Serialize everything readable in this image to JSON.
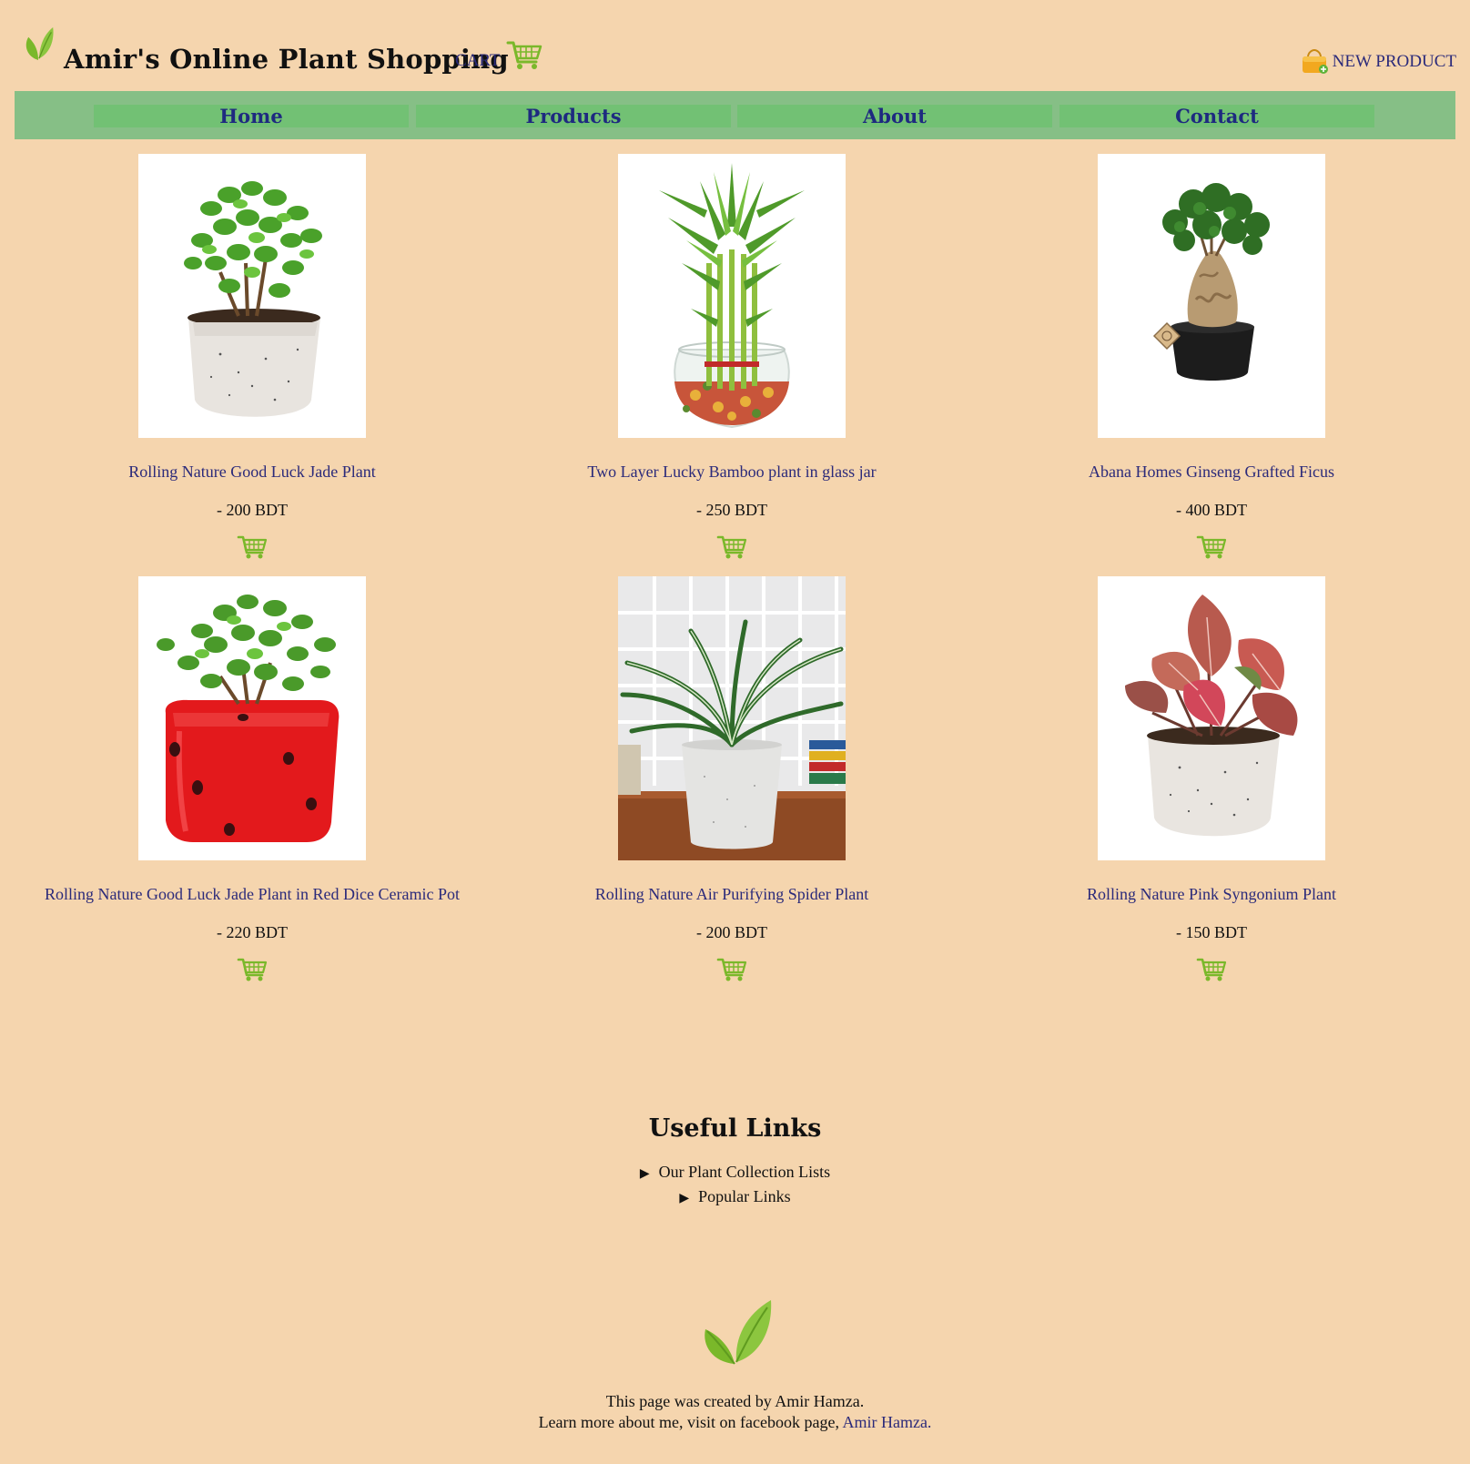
{
  "header": {
    "title": "Amir's Online Plant Shopping",
    "cart_label": "CART",
    "new_product_label": "NEW PRODUCT"
  },
  "nav": {
    "items": [
      "Home",
      "Products",
      "About",
      "Contact"
    ]
  },
  "products": [
    {
      "name": "Rolling Nature Good Luck Jade Plant",
      "price": "- 200 BDT",
      "image": "jade-plant-white-pot"
    },
    {
      "name": "Two Layer Lucky Bamboo plant in glass jar",
      "price": "- 250 BDT",
      "image": "lucky-bamboo-glass-jar"
    },
    {
      "name": "Abana Homes Ginseng Grafted Ficus",
      "price": "- 400 BDT",
      "image": "ginseng-ficus-black-pot"
    },
    {
      "name": "Rolling Nature Good Luck Jade Plant in Red Dice Ceramic Pot",
      "price": "- 220 BDT",
      "image": "jade-plant-red-dice-pot"
    },
    {
      "name": "Rolling Nature Air Purifying Spider Plant",
      "price": "- 200 BDT",
      "image": "spider-plant-white-pot"
    },
    {
      "name": "Rolling Nature Pink Syngonium Plant",
      "price": "- 150 BDT",
      "image": "pink-syngonium-white-pot"
    }
  ],
  "useful_links": {
    "heading": "Useful Links",
    "items": [
      "Our Plant Collection Lists",
      "Popular Links"
    ]
  },
  "footer": {
    "line1": "This page was created by Amir Hamza.",
    "line2": "Learn more about me, visit on facebook page,",
    "link_text": "Amir Hamza."
  },
  "colors": {
    "background": "#f5d5ae",
    "nav_bar": "#86bf86",
    "nav_item": "#72c174",
    "link": "#2b2a7a",
    "nav_text": "#1e2a80",
    "leaf": "#7ab82a"
  },
  "icons": {
    "logo": "leaf-icon",
    "cart": "shopping-cart-icon",
    "new_product": "shopping-bag-icon"
  }
}
